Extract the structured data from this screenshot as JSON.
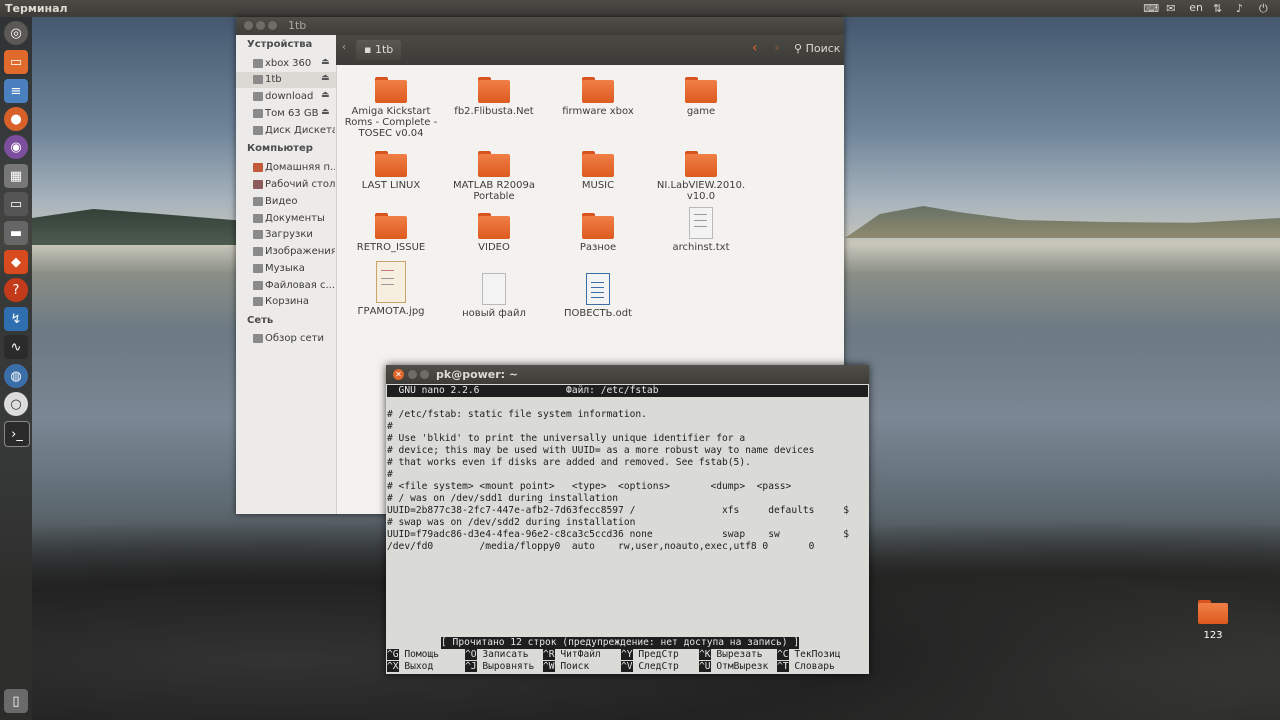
{
  "top_panel": {
    "title": "Терминал",
    "lang": "en",
    "time": ""
  },
  "file_manager": {
    "window_title": "1tb",
    "path_segment": "1tb",
    "search_label": "Поиск",
    "sidebar": {
      "devices_head": "Устройства",
      "devices": [
        "xbox 360",
        "1tb",
        "download",
        "Том 63 GB",
        "Диск Дискета"
      ],
      "computer_head": "Компьютер",
      "computer": [
        "Домашняя п...",
        "Рабочий стол",
        "Видео",
        "Документы",
        "Загрузки",
        "Изображения",
        "Музыка",
        "Файловая с...",
        "Корзина"
      ],
      "network_head": "Сеть",
      "network": [
        "Обзор сети"
      ]
    },
    "items": [
      {
        "label": "Amiga Kickstart Roms - Complete - TOSEC v0.04",
        "kind": "folder"
      },
      {
        "label": "fb2.Flibusta.Net",
        "kind": "folder"
      },
      {
        "label": "firmware xbox",
        "kind": "folder"
      },
      {
        "label": "game",
        "kind": "folder"
      },
      {
        "label": "LAST LINUX",
        "kind": "folder"
      },
      {
        "label": "MATLAB R2009a Portable",
        "kind": "folder"
      },
      {
        "label": "MUSIC",
        "kind": "folder"
      },
      {
        "label": "NI.LabVIEW.2010. v10.0",
        "kind": "folder"
      },
      {
        "label": "RETRO_ISSUE",
        "kind": "folder"
      },
      {
        "label": "VIDEO",
        "kind": "folder"
      },
      {
        "label": "Разное",
        "kind": "folder"
      },
      {
        "label": "archinst.txt",
        "kind": "text"
      },
      {
        "label": "ГРАМОТА.jpg",
        "kind": "image"
      },
      {
        "label": "новый файл",
        "kind": "blank"
      },
      {
        "label": "ПОВЕСТЬ.odt",
        "kind": "doc"
      }
    ]
  },
  "terminal": {
    "window_title": "pk@power: ~",
    "nano_header": "  GNU nano 2.2.6               Файл: /etc/fstab",
    "lines": [
      "# /etc/fstab: static file system information.",
      "#",
      "# Use 'blkid' to print the universally unique identifier for a",
      "# device; this may be used with UUID= as a more robust way to name devices",
      "# that works even if disks are added and removed. See fstab(5).",
      "#",
      "# <file system> <mount point>   <type>  <options>       <dump>  <pass>",
      "# / was on /dev/sdd1 during installation",
      "UUID=2b877c38-2fc7-447e-afb2-7d63fecc8597 /               xfs     defaults     $",
      "# swap was on /dev/sdd2 during installation",
      "UUID=f79adc86-d3e4-4fea-96e2-c8ca3c5ccd36 none            swap    sw           $",
      "/dev/fd0        /media/floppy0  auto    rw,user,noauto,exec,utf8 0       0"
    ],
    "status": "[ Прочитано 12 строк (предупреждение: нет доступа на запись) ]",
    "shortcuts_row1": [
      {
        "key": "^G",
        "label": "Помощь"
      },
      {
        "key": "^O",
        "label": "Записать"
      },
      {
        "key": "^R",
        "label": "ЧитФайл"
      },
      {
        "key": "^Y",
        "label": "ПредСтр"
      },
      {
        "key": "^K",
        "label": "Вырезать"
      },
      {
        "key": "^C",
        "label": "ТекПозиц"
      }
    ],
    "shortcuts_row2": [
      {
        "key": "^X",
        "label": "Выход"
      },
      {
        "key": "^J",
        "label": "Выровнять"
      },
      {
        "key": "^W",
        "label": "Поиск"
      },
      {
        "key": "^V",
        "label": "СледСтр"
      },
      {
        "key": "^U",
        "label": "ОтмВырезк"
      },
      {
        "key": "^T",
        "label": "Словарь"
      }
    ]
  },
  "desktop": {
    "icon_label": "123"
  },
  "colors": {
    "accent": "#e0672b",
    "folder": "#ef7a3f",
    "panel": "#3c3b37"
  }
}
